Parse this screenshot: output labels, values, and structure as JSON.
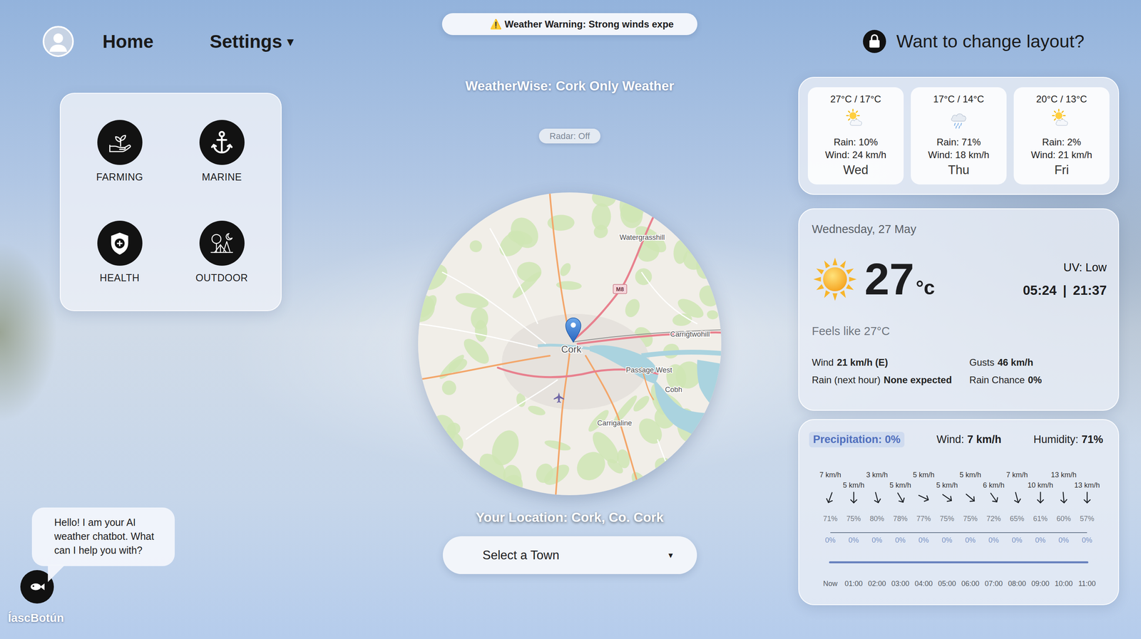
{
  "header": {
    "nav": [
      {
        "label": "Home",
        "has_menu": false
      },
      {
        "label": "Settings",
        "has_menu": true
      }
    ],
    "menu_caret": "▾",
    "ticker": "⚠️ Weather Warning: Strong winds expe",
    "layout_button": "Want to change layout?"
  },
  "categories": [
    {
      "label": "FARMING",
      "kind": "farming"
    },
    {
      "label": "MARINE",
      "kind": "marine"
    },
    {
      "label": "HEALTH",
      "kind": "health"
    },
    {
      "label": "OUTDOOR",
      "kind": "outdoor"
    }
  ],
  "title": "WeatherWise: Cork Only Weather",
  "radar": {
    "label": "Radar: Off",
    "on": false
  },
  "map": {
    "places": [
      "Watergrasshill",
      "Carrigtwohill",
      "Cork",
      "Passage West",
      "Cobh",
      "Carrigaline"
    ],
    "road_shield": "M8"
  },
  "location": "Your Location: Cork, Co. Cork",
  "town_select": {
    "placeholder": "Select a Town",
    "caret": "▾"
  },
  "chatbot": {
    "message": "Hello! I am your AI weather chatbot. What can I help you with?",
    "name": "ÍascBotún"
  },
  "forecast": [
    {
      "day": "Wed",
      "temps": "27°C / 17°C",
      "rain": "Rain: 10%",
      "wind": "Wind: 24 km/h",
      "kind": "partly-sunny"
    },
    {
      "day": "Thu",
      "temps": "17°C / 14°C",
      "rain": "Rain: 71%",
      "wind": "Wind: 18 km/h",
      "kind": "rain"
    },
    {
      "day": "Fri",
      "temps": "20°C / 13°C",
      "rain": "Rain: 2%",
      "wind": "Wind: 21 km/h",
      "kind": "partly-sunny"
    }
  ],
  "current": {
    "date": "Wednesday, 27 May",
    "temp": "27",
    "unit": "°c",
    "uv": "UV: Low",
    "sunrise": "05:24",
    "separator": "|",
    "sunset": "21:37",
    "feels": "Feels like 27°C",
    "details": [
      {
        "label": "Wind",
        "value": "21 km/h (E)"
      },
      {
        "label": "Gusts",
        "value": "46 km/h"
      },
      {
        "label": "Rain (next hour)",
        "value": "None expected"
      },
      {
        "label": "Rain Chance",
        "value": "0%"
      }
    ]
  },
  "hourly": {
    "summary": {
      "precipitation": "Precipitation: 0%",
      "wind_label": "Wind:",
      "wind_value": "7 km/h",
      "humidity_label": "Humidity:",
      "humidity_value": "71%"
    },
    "hours": [
      {
        "time": "Now",
        "wind": "7 km/h",
        "direction": 200,
        "humidity": "71%",
        "precip": "0%"
      },
      {
        "time": "01:00",
        "wind": "5 km/h",
        "direction": 180,
        "humidity": "75%",
        "precip": "0%"
      },
      {
        "time": "02:00",
        "wind": "3 km/h",
        "direction": 165,
        "humidity": "80%",
        "precip": "0%"
      },
      {
        "time": "03:00",
        "wind": "5 km/h",
        "direction": 150,
        "humidity": "78%",
        "precip": "0%"
      },
      {
        "time": "04:00",
        "wind": "5 km/h",
        "direction": 115,
        "humidity": "77%",
        "precip": "0%"
      },
      {
        "time": "05:00",
        "wind": "5 km/h",
        "direction": 125,
        "humidity": "75%",
        "precip": "0%"
      },
      {
        "time": "06:00",
        "wind": "5 km/h",
        "direction": 130,
        "humidity": "75%",
        "precip": "0%"
      },
      {
        "time": "07:00",
        "wind": "6 km/h",
        "direction": 145,
        "humidity": "72%",
        "precip": "0%"
      },
      {
        "time": "08:00",
        "wind": "7 km/h",
        "direction": 165,
        "humidity": "65%",
        "precip": "0%"
      },
      {
        "time": "09:00",
        "wind": "10 km/h",
        "direction": 180,
        "humidity": "61%",
        "precip": "0%"
      },
      {
        "time": "10:00",
        "wind": "13 km/h",
        "direction": 175,
        "humidity": "60%",
        "precip": "0%"
      },
      {
        "time": "11:00",
        "wind": "13 km/h",
        "direction": 180,
        "humidity": "57%",
        "precip": "0%"
      }
    ],
    "precip_chart": {
      "values": [
        0,
        0,
        0,
        0,
        0,
        0,
        0,
        0,
        0,
        0,
        0,
        0
      ]
    }
  }
}
